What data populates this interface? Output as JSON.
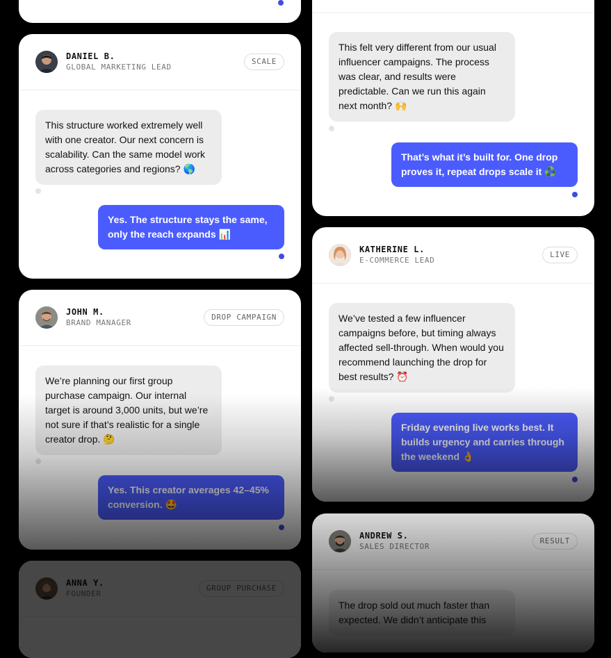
{
  "cards": {
    "daniel": {
      "name": "DANIEL B.",
      "role": "GLOBAL MARKETING LEAD",
      "tag": "SCALE",
      "incoming": "This structure worked extremely well with one creator. Our next concern is scalability. Can the same model work across categories and regions? 🌎",
      "outgoing": "Yes. The structure stays the same, only the reach expands 📊"
    },
    "john": {
      "name": "JOHN M.",
      "role": "BRAND MANAGER",
      "tag": "DROP CAMPAIGN",
      "incoming": "We’re planning our first group purchase campaign. Our internal target is around 3,000 units, but we’re not sure if that’s realistic for a single creator drop. 🤔",
      "outgoing": "Yes. This creator averages 42–45% conversion. 🤩"
    },
    "anna": {
      "name": "ANNA Y.",
      "role": "FOUNDER",
      "tag": "GROUP PURCHASE"
    },
    "top_right": {
      "incoming": "This felt very different from our usual influencer campaigns. The process was clear, and results were predictable. Can we run this again next month? 🙌",
      "outgoing": "That’s what it’s built for. One drop proves it, repeat drops scale it ♻️"
    },
    "katherine": {
      "name": "KATHERINE L.",
      "role": "E-COMMERCE LEAD",
      "tag": "LIVE",
      "incoming": "We’ve tested a few influencer campaigns before, but timing always affected sell-through. When would you recommend launching the drop for best results? ⏰",
      "outgoing": "Friday evening live works best. It builds urgency and carries through the weekend 👌"
    },
    "andrew": {
      "name": "ANDREW S.",
      "role": "SALES DIRECTOR",
      "tag": "RESULT",
      "incoming": "The drop sold out much faster than expected. We didn’t anticipate this"
    }
  },
  "colors": {
    "outgoing_bubble": "#4b5cff",
    "incoming_bubble": "#ececec",
    "background": "#000000"
  },
  "icons": [
    "avatar-daniel",
    "avatar-john",
    "avatar-anna",
    "avatar-katherine",
    "avatar-andrew"
  ]
}
